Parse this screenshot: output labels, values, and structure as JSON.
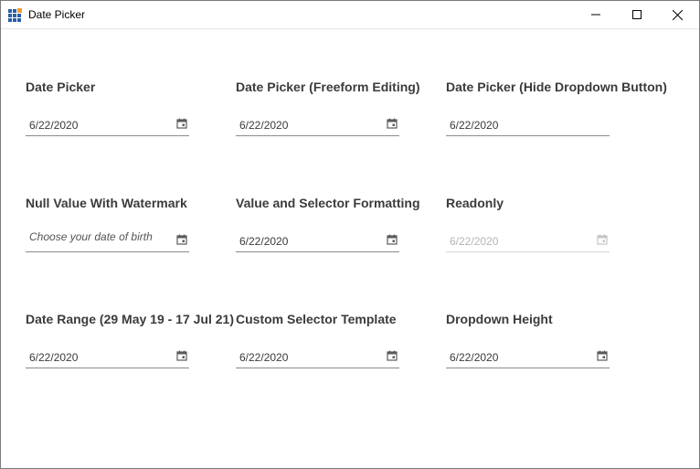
{
  "window": {
    "title": "Date Picker"
  },
  "sections": [
    {
      "label": "Date Picker",
      "value": "6/22/2020"
    },
    {
      "label": "Date Picker (Freeform Editing)",
      "value": "6/22/2020"
    },
    {
      "label": "Date Picker (Hide Dropdown Button)",
      "value": "6/22/2020"
    },
    {
      "label": "Null Value With Watermark",
      "placeholder": "Choose your date of birth"
    },
    {
      "label": "Value and Selector Formatting",
      "value": "6/22/2020"
    },
    {
      "label": "Readonly",
      "value": "6/22/2020"
    },
    {
      "label": "Date Range (29 May 19 - 17 Jul 21)",
      "value": "6/22/2020"
    },
    {
      "label": "Custom Selector Template",
      "value": "6/22/2020"
    },
    {
      "label": "Dropdown Height",
      "value": "6/22/2020"
    }
  ],
  "colors": {
    "icon": "#5a5a5a",
    "readonly": "#b4b4b4",
    "appIconBlue": "#2b5fa8",
    "appIconOrange": "#f0a02a"
  },
  "icons": {
    "calendar": "calendar-icon",
    "minimize": "minimize-icon",
    "maximize": "maximize-icon",
    "close": "close-icon"
  }
}
